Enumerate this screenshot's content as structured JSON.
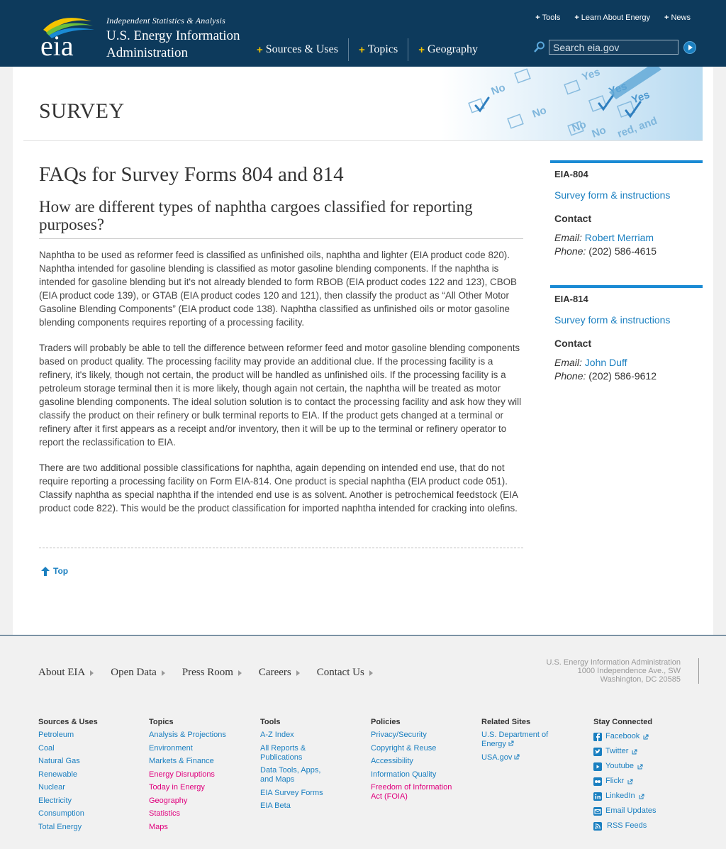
{
  "header": {
    "tagline": "Independent Statistics & Analysis",
    "agency_line1": "U.S. Energy Information",
    "agency_line2": "Administration",
    "logo_text": "eia",
    "top_links": [
      "Tools",
      "Learn About Energy",
      "News"
    ],
    "main_nav": [
      "Sources & Uses",
      "Topics",
      "Geography"
    ],
    "search_placeholder": "Search eia.gov"
  },
  "banner": {
    "title": "SURVEY",
    "art_words": [
      "No",
      "No",
      "Yes",
      "Yes",
      "No",
      "No",
      "Yes",
      "red, and"
    ]
  },
  "main": {
    "title": "FAQs for Survey Forms 804 and 814",
    "question": "How are different types of naphtha cargoes classified for reporting purposes?",
    "paragraphs": [
      "Naphtha to be used as reformer feed is classified as unfinished oils, naphtha and lighter (EIA product code 820). Naphtha intended for gasoline blending is classified as motor gasoline blending components. If the naphtha is intended for gasoline blending but it's not already blended to form RBOB (EIA product codes 122 and 123), CBOB (EIA product code 139), or GTAB (EIA product codes 120 and 121), then classify the product as “All Other Motor Gasoline Blending Components” (EIA product code 138). Naphtha classified as unfinished oils or motor gasoline blending components requires reporting of a processing facility.",
      "Traders will probably be able to tell the difference between reformer feed and motor gasoline blending components based on product quality. The processing facility may provide an additional clue. If the processing facility is a refinery, it's likely, though not certain, the product will be handled as unfinished oils. If the processing facility is a petroleum storage terminal then it is more likely, though again not certain, the naphtha will be treated as motor gasoline blending components. The ideal solution solution is to contact the processing facility and ask how they will classify the product on their refinery or bulk terminal reports to EIA. If the product gets changed at a terminal or refinery after it first appears as a receipt and/or inventory, then it will be up to the terminal or refinery operator to report the reclassification to EIA.",
      "There are two additional possible classifications for naphtha, again depending on intended end use, that do not require reporting a processing facility on Form EIA-814. One product is special naphtha (EIA product code 051). Classify naphtha as special naphtha if the intended end use is as solvent. Another is petrochemical feedstock (EIA product code 822). This would be the product classification for imported naphtha intended for cracking into olefins."
    ],
    "top_label": "Top"
  },
  "sidebar": [
    {
      "title": "EIA-804",
      "link": "Survey form & instructions",
      "contact_label": "Contact",
      "email_label": "Email:",
      "email_name": "Robert Merriam",
      "phone_label": "Phone:",
      "phone": "(202) 586-4615"
    },
    {
      "title": "EIA-814",
      "link": "Survey form & instructions",
      "contact_label": "Contact",
      "email_label": "Email:",
      "email_name": "John Duff",
      "phone_label": "Phone:",
      "phone": "(202) 586-9612"
    }
  ],
  "footer": {
    "nav": [
      "About EIA",
      "Open Data",
      "Press Room",
      "Careers",
      "Contact Us"
    ],
    "address": [
      "U.S. Energy Information Administration",
      "1000 Independence Ave., SW",
      "Washington, DC 20585"
    ],
    "columns": [
      {
        "title": "Sources & Uses",
        "items": [
          "Petroleum",
          "Coal",
          "Natural Gas",
          "Renewable",
          "Nuclear",
          "Electricity",
          "Consumption",
          "Total Energy"
        ]
      },
      {
        "title": "Topics",
        "items": [
          "Analysis & Projections",
          "Environment",
          "Markets & Finance",
          "Energy Disruptions",
          "Today in Energy",
          "Geography",
          "Statistics",
          "Maps"
        ]
      },
      {
        "title": "Tools",
        "items": [
          "A-Z Index",
          "All Reports & Publications",
          "Data Tools, Apps, and Maps",
          "EIA Survey Forms",
          "EIA Beta"
        ]
      },
      {
        "title": "Policies",
        "items": [
          "Privacy/Security",
          "Copyright & Reuse",
          "Accessibility",
          "Information Quality",
          "Freedom of Information Act (FOIA)"
        ]
      },
      {
        "title": "Related Sites",
        "items": [
          "U.S. Department of Energy",
          "USA.gov"
        ]
      },
      {
        "title": "Stay Connected",
        "items": [
          "Facebook",
          "Twitter",
          "Youtube",
          "Flickr",
          "LinkedIn",
          "Email Updates",
          "RSS Feeds"
        ]
      }
    ]
  },
  "colors": {
    "header_bg": "#0d3a5c",
    "link": "#1a7fc0",
    "accent_plus": "#f4c400",
    "sidebar_rule": "#1a8ad4"
  }
}
